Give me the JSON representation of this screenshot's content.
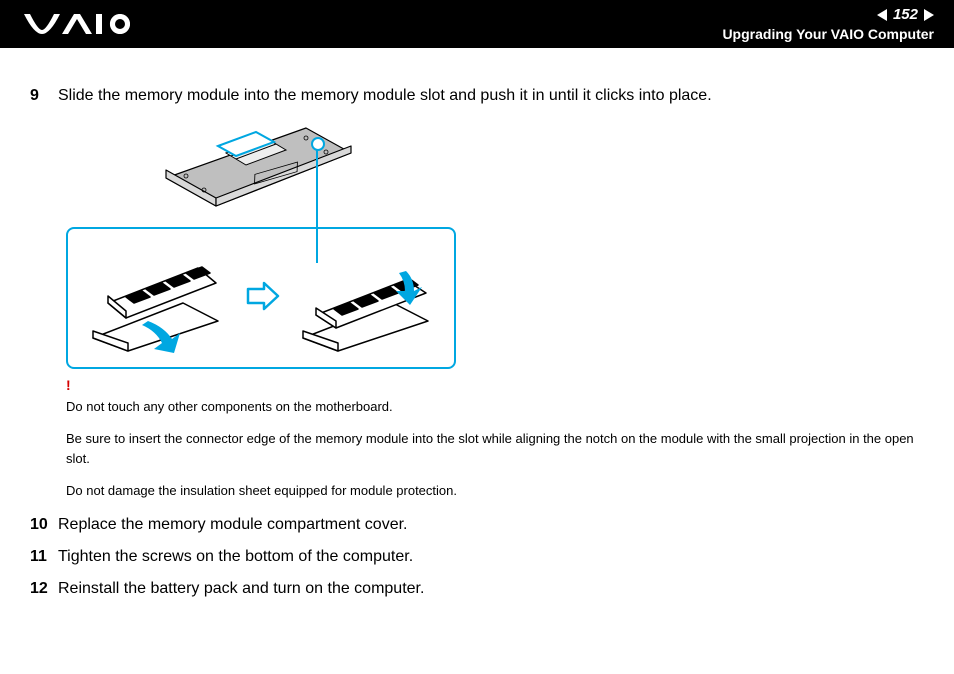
{
  "header": {
    "page_number": "152",
    "section_title": "Upgrading Your VAIO Computer",
    "logo_alt": "VAIO"
  },
  "steps": {
    "s9": {
      "num": "9",
      "text": "Slide the memory module into the memory module slot and push it in until it clicks into place."
    },
    "s10": {
      "num": "10",
      "text": "Replace the memory module compartment cover."
    },
    "s11": {
      "num": "11",
      "text": "Tighten the screws on the bottom of the computer."
    },
    "s12": {
      "num": "12",
      "text": "Reinstall the battery pack and turn on the computer."
    }
  },
  "caution": {
    "mark": "!",
    "line1": "Do not touch any other components on the motherboard.",
    "line2": "Be sure to insert the connector edge of the memory module into the slot while aligning the notch on the module with the small projection in the open slot.",
    "line3": "Do not damage the insulation sheet equipped for module protection."
  },
  "figure": {
    "laptop_alt": "Underside of VAIO laptop with memory compartment highlighted",
    "step1_alt": "Insert memory module at an angle",
    "arrow_alt": "then",
    "step2_alt": "Push memory module down until it clicks"
  }
}
